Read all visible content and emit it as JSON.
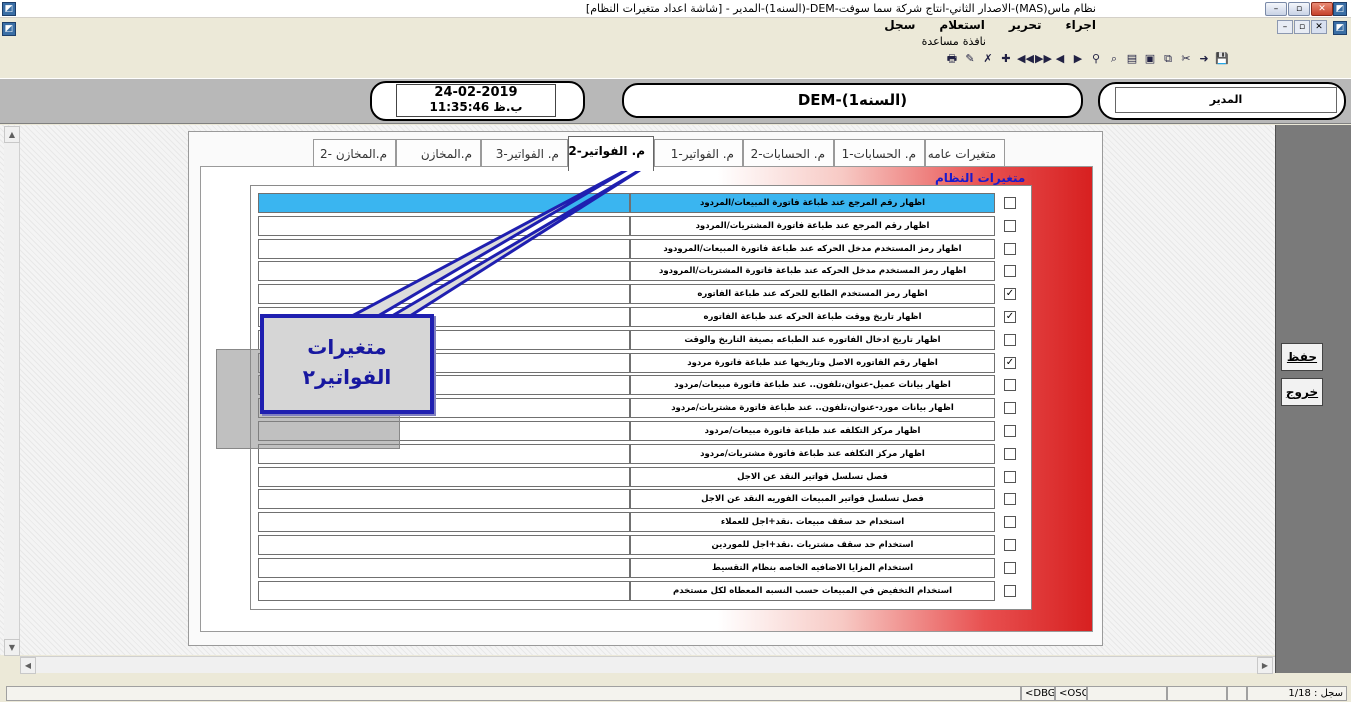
{
  "window": {
    "title": "نظام ماس(MAS)-الاصدار الثاني-انتاج شركة سما سوفت-DEM-(السنه1)-المدير - [شاشة اعداد متغيرات النظام]"
  },
  "menu": {
    "items": [
      "اجراء",
      "تحرير",
      "استعلام",
      "سجل",
      "نافذة",
      "مساعدة"
    ]
  },
  "toolbar": {
    "icons": [
      "save-icon",
      "exit-icon",
      "cut-icon",
      "copy-icon",
      "paste-icon",
      "new-icon",
      "find-icon",
      "filter-icon",
      "prev-icon",
      "next-icon",
      "first-icon",
      "last-icon",
      "add-icon",
      "delete-icon",
      "tools-icon",
      "print-icon"
    ]
  },
  "header": {
    "date": "24-02-2019",
    "time": "11:35:46 ب.ظ",
    "company": "DEM-(السنه1)",
    "user": "المدير"
  },
  "tabs": [
    {
      "label": "متغيرات عامه",
      "active": false
    },
    {
      "label": "م. الحسابات-1",
      "active": false
    },
    {
      "label": "م. الحسابات-2",
      "active": false
    },
    {
      "label": "م. الفواتير-1",
      "active": false
    },
    {
      "label": "م. الفواتير-2",
      "active": true
    },
    {
      "label": "م. الفواتير-3",
      "active": false
    },
    {
      "label": "م.المخازن",
      "active": false
    },
    {
      "label": "م.المخازن -2",
      "active": false
    }
  ],
  "group_title": "متغيرات النظام",
  "rows": [
    {
      "label": "اظهار رقم المرجع عند طباعة فاتورة المبيعات/المردود",
      "checked": false,
      "value": "",
      "selected": true
    },
    {
      "label": "اظهار رقم المرجع عند طباعة فاتورة المشتريات/المردود",
      "checked": false,
      "value": "",
      "selected": false
    },
    {
      "label": "اظهار رمز المستخدم مدخل الحركه عند طباعة فاتورة المبيعات/المرودود",
      "checked": false,
      "value": "",
      "selected": false
    },
    {
      "label": "اظهار رمز المستخدم مدخل الحركه عند طباعة فاتورة المشتريات/المرودود",
      "checked": false,
      "value": "",
      "selected": false
    },
    {
      "label": "اظهار رمز المستخدم الطابع للحركه عند طباعة الفاتوره",
      "checked": true,
      "value": "",
      "selected": false
    },
    {
      "label": "اظهار تاريخ ووقت طباعة الحركه عند طباعة الفاتوره",
      "checked": true,
      "value": "",
      "selected": false
    },
    {
      "label": "اظهار تاريخ ادخال الفاتوره عند الطباعه بصيغة التاريخ والوقت",
      "checked": false,
      "value": "",
      "selected": false
    },
    {
      "label": "اظهار رقم الفاتوره الاصل وتاريخها عند طباعة فاتورة مردود",
      "checked": true,
      "value": "",
      "selected": false
    },
    {
      "label": "اظهار بيانات عميل-عنوان،تلفون.. عند طباعة فاتورة مبيعات/مردود",
      "checked": false,
      "value": "",
      "selected": false
    },
    {
      "label": "اظهار بيانات مورد-عنوان،تلفون.. عند طباعة فاتورة مشتريات/مردود",
      "checked": false,
      "value": "",
      "selected": false
    },
    {
      "label": "اظهار مركز التكلفه عند طباعة فاتورة مبيعات/مردود",
      "checked": false,
      "value": "",
      "selected": false
    },
    {
      "label": "اظهار مركز التكلفه عند طباعة فاتورة مشتريات/مردود",
      "checked": false,
      "value": "",
      "selected": false
    },
    {
      "label": "فصل تسلسل فواتير النقد عن الاجل",
      "checked": false,
      "value": "",
      "selected": false
    },
    {
      "label": "فصل تسلسل فواتير المبيعات الفوريه النقد عن الاجل",
      "checked": false,
      "value": "",
      "selected": false
    },
    {
      "label": "استخدام حد سقف مبيعات .نقد+اجل للعملاء",
      "checked": false,
      "value": "",
      "selected": false
    },
    {
      "label": "استخدام حد سقف مشتريات .نقد+اجل للموردين",
      "checked": false,
      "value": "",
      "selected": false
    },
    {
      "label": "استخدام المزايا الاضافيه الخاصه بنظام التقسيط",
      "checked": false,
      "value": "",
      "selected": false
    },
    {
      "label": "استخدام التخفيض في المبيعات حسب النسبه المعطاه لكل مستخدم",
      "checked": false,
      "value": "",
      "selected": false
    }
  ],
  "callout": {
    "line1": "متغيرات",
    "line2": "الفواتير٢"
  },
  "side_buttons": {
    "save": "حفظ",
    "exit": "خروج"
  },
  "statusbar": {
    "record": "سجل : 1/18",
    "dbg": "<DBG>",
    "osc": "<OSC>"
  },
  "colors": {
    "selected_row": "#3ab5f0",
    "callout_border": "#1f1fb0",
    "group_title": "#1a1acc"
  }
}
